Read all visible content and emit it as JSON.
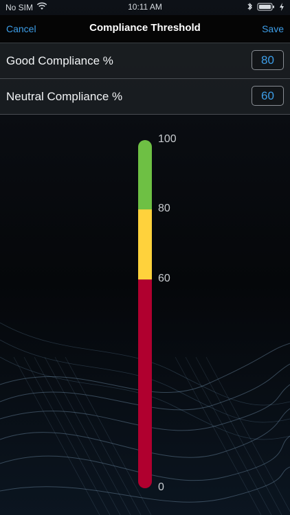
{
  "status": {
    "carrier": "No SIM",
    "time": "10:11 AM"
  },
  "header": {
    "cancel_label": "Cancel",
    "title": "Compliance Threshold",
    "save_label": "Save"
  },
  "settings": {
    "good": {
      "label": "Good Compliance %",
      "value": "80"
    },
    "neutral": {
      "label": "Neutral Compliance %",
      "value": "60"
    }
  },
  "gauge": {
    "min": 0,
    "max": 100,
    "labels": [
      "100",
      "80",
      "60",
      "0"
    ],
    "segments": [
      {
        "name": "good",
        "from": 80,
        "to": 100,
        "color": "#6ec044"
      },
      {
        "name": "neutral",
        "from": 60,
        "to": 80,
        "color": "#ffd23c"
      },
      {
        "name": "poor",
        "from": 0,
        "to": 60,
        "color": "#b0002f"
      }
    ]
  },
  "colors": {
    "accent": "#3d9ee8",
    "background": "#0b0f14"
  },
  "icons": {
    "wifi": "wifi-icon",
    "bluetooth": "bluetooth-icon",
    "battery": "battery-icon",
    "charging": "charging-bolt-icon"
  }
}
